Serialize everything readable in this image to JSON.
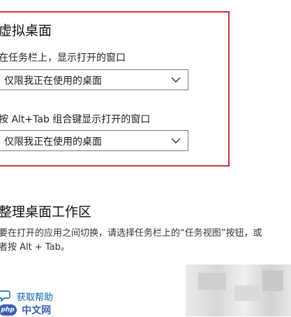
{
  "virtual_desktops": {
    "title": "虚拟桌面",
    "taskbar_label": "在任务栏上，显示打开的窗口",
    "taskbar_value": "仅限我正在使用的桌面",
    "alttab_label": "按 Alt+Tab 组合键显示打开的窗口",
    "alttab_value": "仅限我正在使用的桌面"
  },
  "arrange": {
    "title": "整理桌面工作区",
    "line1": "要在打开的应用之间切换，请选择任务栏上的“任务视图”按钮，或",
    "line2": "者按 Alt + Tab。"
  },
  "help": {
    "link": "获取帮助"
  },
  "watermark": {
    "badge": "php",
    "text": "中文网"
  },
  "colors": {
    "highlight": "#c8323a",
    "link": "#0063b1"
  }
}
